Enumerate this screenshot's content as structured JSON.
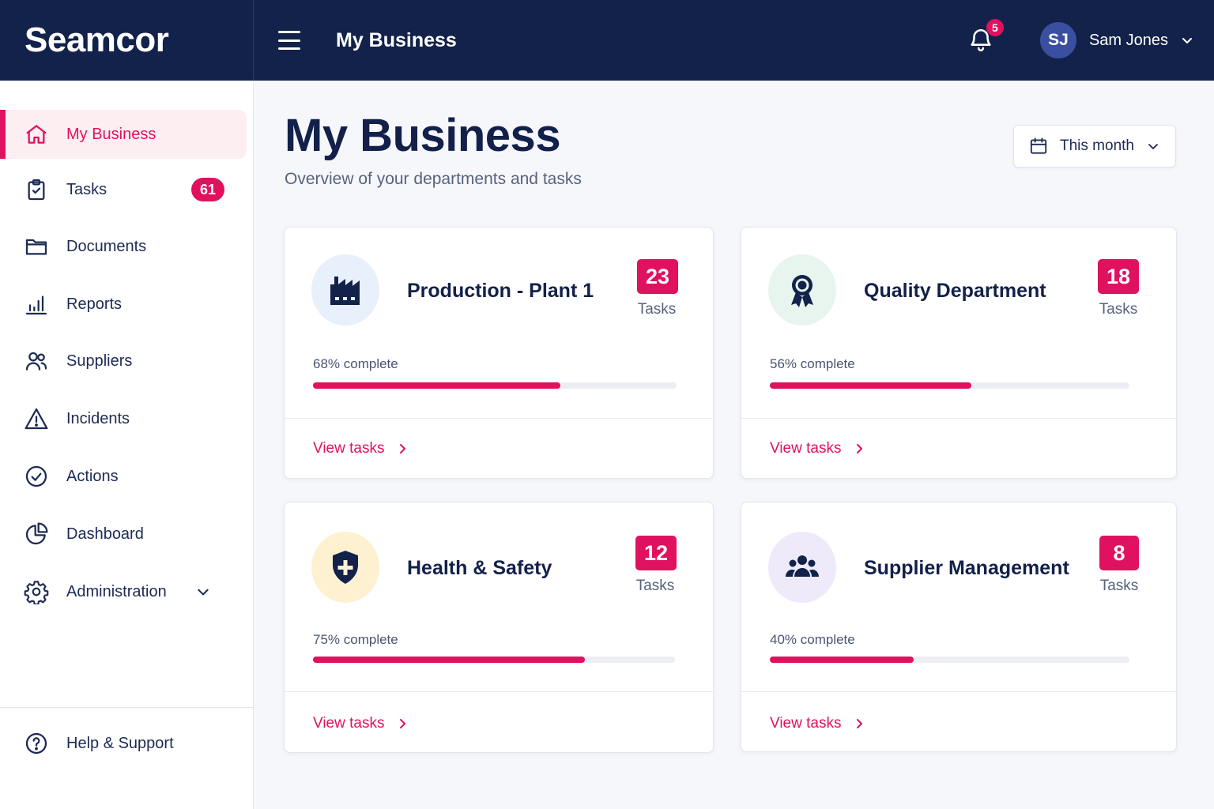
{
  "app": {
    "brand": "Seamcor",
    "header_title": "My Business"
  },
  "notifications": {
    "count": "5"
  },
  "user": {
    "initials": "SJ",
    "name": "Sam Jones"
  },
  "sidebar": {
    "items": [
      {
        "label": "My Business",
        "icon": "home-icon",
        "active": true
      },
      {
        "label": "Tasks",
        "icon": "clipboard-check-icon",
        "badge": "61"
      },
      {
        "label": "Documents",
        "icon": "folder-icon"
      },
      {
        "label": "Reports",
        "icon": "bar-chart-icon"
      },
      {
        "label": "Suppliers",
        "icon": "users-icon"
      },
      {
        "label": "Incidents",
        "icon": "warning-icon"
      },
      {
        "label": "Actions",
        "icon": "check-circle-icon"
      },
      {
        "label": "Dashboard",
        "icon": "pie-chart-icon"
      },
      {
        "label": "Administration",
        "icon": "gear-icon",
        "expandable": true
      }
    ],
    "footer": {
      "label": "Help & Support",
      "icon": "help-circle-icon"
    }
  },
  "main": {
    "title": "My Business",
    "subtitle": "Overview of your departments and tasks",
    "period": {
      "selected": "This month"
    },
    "cards": [
      {
        "title": "Production - Plant 1",
        "icon": "factory-icon",
        "tasks": "23",
        "tasks_label": "Tasks",
        "progress_label": "68% complete",
        "progress": 68,
        "link": "View tasks"
      },
      {
        "title": "Quality Department",
        "icon": "award-icon",
        "tasks": "18",
        "tasks_label": "Tasks",
        "progress_label": "56% complete",
        "progress": 56,
        "link": "View tasks"
      },
      {
        "title": "Health & Safety",
        "icon": "shield-plus-icon",
        "tasks": "12",
        "tasks_label": "Tasks",
        "progress_label": "75% complete",
        "progress": 75,
        "link": "View tasks"
      },
      {
        "title": "Supplier Management",
        "icon": "group-icon",
        "tasks": "8",
        "tasks_label": "Tasks",
        "progress_label": "40% complete",
        "progress": 40,
        "link": "View tasks"
      }
    ]
  },
  "colors": {
    "accent": "#e0115f",
    "navy": "#12224a",
    "active_bg": "#fdeef2"
  }
}
